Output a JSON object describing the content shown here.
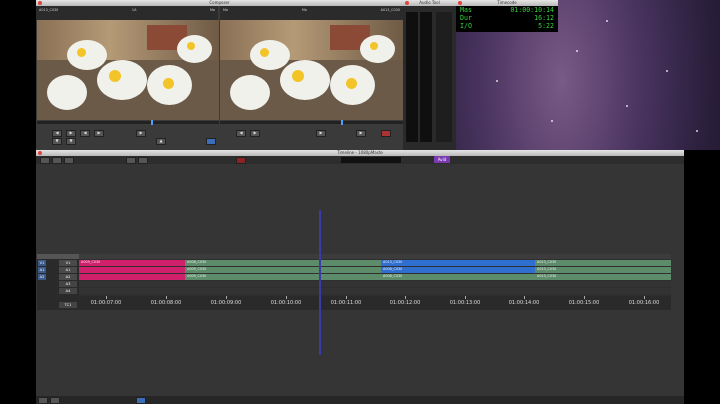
{
  "composer": {
    "title": "Composer",
    "left_info": [
      "1A",
      "Ma"
    ],
    "left_clip": "A013_C030",
    "right_info": [
      "Ma",
      "Ma"
    ],
    "right_clip": "A013_C030"
  },
  "audio_tool": {
    "title": "Audio Tool"
  },
  "timecode": {
    "title": "Timecode",
    "rows": [
      {
        "label": "Mas",
        "value": "01:00:10:14"
      },
      {
        "label": "Dur",
        "value": "16:12"
      },
      {
        "label": "I/O",
        "value": "5:22"
      }
    ]
  },
  "timeline": {
    "title": "Timeline - 1080pMaste",
    "badge": "Avid",
    "tracks": [
      {
        "name": "V1",
        "patch": "V1"
      },
      {
        "name": "A1",
        "patch": "A1"
      },
      {
        "name": "A2",
        "patch": "A2"
      },
      {
        "name": "A3",
        "patch": ""
      },
      {
        "name": "A4",
        "patch": ""
      },
      {
        "name": "TC1",
        "patch": ""
      }
    ],
    "clips": {
      "video": [
        "A009_C030",
        "A008_C030",
        "A013_C030",
        "A013_C030"
      ],
      "audio1": [
        "A009_C030",
        "A008_C030",
        "A013_C030"
      ],
      "audio2": [
        "A009_C030",
        "A008_C030",
        "A013_C030"
      ]
    },
    "ruler": [
      "01:00:07:00",
      "01:00:08:00",
      "01:00:09:00",
      "01:00:10:00",
      "01:00:11:00",
      "01:00:12:00",
      "01:00:13:00",
      "01:00:14:00",
      "01:00:15:00",
      "01:00:16:00"
    ]
  },
  "colors": {
    "clip_magenta": "#d0206c",
    "clip_green": "#5c8c6a",
    "clip_blue": "#2f6fd0",
    "timecode_green": "#31d43e"
  }
}
